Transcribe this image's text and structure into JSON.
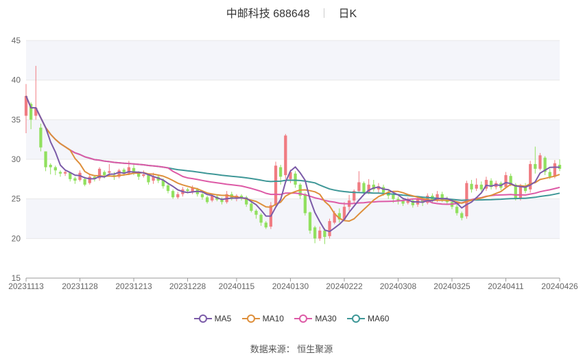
{
  "header": {
    "stock": "中邮科技 688648",
    "period": "日K"
  },
  "source": "数据来源：  恒生聚源",
  "colors": {
    "up": "#f07c82",
    "down": "#91e05f",
    "ma5": "#7b5ba8",
    "ma10": "#de8f3b",
    "ma30": "#dd5aa6",
    "ma60": "#3e9797",
    "grid": "#e8e8e8",
    "band": "#f4f5fa"
  },
  "chart_data": {
    "type": "candlestick",
    "title": "中邮科技 688648",
    "ylim": [
      15,
      45
    ],
    "yticks": [
      15,
      20,
      25,
      30,
      35,
      40,
      45
    ],
    "xtick_labels": [
      "20231113",
      "20231128",
      "20231213",
      "20231228",
      "20240115",
      "20240130",
      "20240222",
      "20240308",
      "20240325",
      "20240411",
      "20240426"
    ],
    "xtick_index": [
      0,
      11,
      22,
      33,
      43,
      54,
      65,
      76,
      87,
      98,
      109
    ],
    "legend": [
      "MA5",
      "MA10",
      "MA30",
      "MA60"
    ],
    "ohlc": [
      [
        35.5,
        38.0,
        39.5,
        33.3
      ],
      [
        37.0,
        35.0,
        37.2,
        33.8
      ],
      [
        35.5,
        36.5,
        41.8,
        35.0
      ],
      [
        34.0,
        31.5,
        34.5,
        31.0
      ],
      [
        31.0,
        29.0,
        31.0,
        28.5
      ],
      [
        29.3,
        29.0,
        29.5,
        28.1
      ],
      [
        29.0,
        28.6,
        29.2,
        28.0
      ],
      [
        28.4,
        28.2,
        28.6,
        27.8
      ],
      [
        28.2,
        28.4,
        28.6,
        27.9
      ],
      [
        28.3,
        27.5,
        28.4,
        27.2
      ],
      [
        27.6,
        27.3,
        27.8,
        26.9
      ],
      [
        27.4,
        28.3,
        28.6,
        27.2
      ],
      [
        27.5,
        26.8,
        27.8,
        26.6
      ],
      [
        27.0,
        27.8,
        28.1,
        26.8
      ],
      [
        27.8,
        27.5,
        28.0,
        27.2
      ],
      [
        27.6,
        28.8,
        29.0,
        27.3
      ],
      [
        28.4,
        28.0,
        28.6,
        27.6
      ],
      [
        28.3,
        28.5,
        29.4,
        27.8
      ],
      [
        28.0,
        27.9,
        28.4,
        27.4
      ],
      [
        27.8,
        28.6,
        28.8,
        27.6
      ],
      [
        28.7,
        28.2,
        28.9,
        27.9
      ],
      [
        28.2,
        29.0,
        29.8,
        28.0
      ],
      [
        28.9,
        28.3,
        29.3,
        28.0
      ],
      [
        28.3,
        27.8,
        28.5,
        27.4
      ],
      [
        27.9,
        28.1,
        28.6,
        27.7
      ],
      [
        28.0,
        27.1,
        28.2,
        26.8
      ],
      [
        27.3,
        27.8,
        28.3,
        26.9
      ],
      [
        27.8,
        27.3,
        28.0,
        27.0
      ],
      [
        27.4,
        26.6,
        27.6,
        26.3
      ],
      [
        26.7,
        26.0,
        26.9,
        25.7
      ],
      [
        26.0,
        25.2,
        26.2,
        25.0
      ],
      [
        25.2,
        25.6,
        25.9,
        25.0
      ],
      [
        25.6,
        26.2,
        26.5,
        25.3
      ],
      [
        26.2,
        26.0,
        26.4,
        25.7
      ],
      [
        25.9,
        26.4,
        26.7,
        25.6
      ],
      [
        26.2,
        25.6,
        26.4,
        25.3
      ],
      [
        25.6,
        25.2,
        25.8,
        24.9
      ],
      [
        25.2,
        24.6,
        25.4,
        24.4
      ],
      [
        24.8,
        25.4,
        25.6,
        24.6
      ],
      [
        25.3,
        24.9,
        25.6,
        24.7
      ],
      [
        24.9,
        24.6,
        25.2,
        24.3
      ],
      [
        24.6,
        25.6,
        26.0,
        24.4
      ],
      [
        25.6,
        25.0,
        25.9,
        24.8
      ],
      [
        25.0,
        25.4,
        25.6,
        24.7
      ],
      [
        25.4,
        25.1,
        25.6,
        24.8
      ],
      [
        25.2,
        24.3,
        25.4,
        24.0
      ],
      [
        24.4,
        23.5,
        24.6,
        23.3
      ],
      [
        23.5,
        23.0,
        23.7,
        22.5
      ],
      [
        23.0,
        22.0,
        23.2,
        21.6
      ],
      [
        22.0,
        21.4,
        22.2,
        21.2
      ],
      [
        21.5,
        24.2,
        24.6,
        21.2
      ],
      [
        24.2,
        29.2,
        29.7,
        24.0
      ],
      [
        29.0,
        27.8,
        29.3,
        26.8
      ],
      [
        28.0,
        33.0,
        33.2,
        27.5
      ],
      [
        27.5,
        28.4,
        28.7,
        27.0
      ],
      [
        28.2,
        26.8,
        28.5,
        26.4
      ],
      [
        26.8,
        25.4,
        27.0,
        25.0
      ],
      [
        25.6,
        23.2,
        25.8,
        22.9
      ],
      [
        23.3,
        21.0,
        23.4,
        20.6
      ],
      [
        21.4,
        20.0,
        21.6,
        19.4
      ],
      [
        20.0,
        21.0,
        21.5,
        19.7
      ],
      [
        21.0,
        20.2,
        21.3,
        19.3
      ],
      [
        20.3,
        22.2,
        22.5,
        20.0
      ],
      [
        22.0,
        23.2,
        23.5,
        21.8
      ],
      [
        23.2,
        22.4,
        23.8,
        22.0
      ],
      [
        22.4,
        24.0,
        24.6,
        22.2
      ],
      [
        24.0,
        24.8,
        25.5,
        23.5
      ],
      [
        24.8,
        26.0,
        26.2,
        24.5
      ],
      [
        26.0,
        27.1,
        28.5,
        25.8
      ],
      [
        27.0,
        25.8,
        27.2,
        25.6
      ],
      [
        25.8,
        26.8,
        27.5,
        25.6
      ],
      [
        26.8,
        26.2,
        27.4,
        25.9
      ],
      [
        26.2,
        26.6,
        27.0,
        25.8
      ],
      [
        26.5,
        25.8,
        26.8,
        25.4
      ],
      [
        25.8,
        25.4,
        26.2,
        25.0
      ],
      [
        25.5,
        25.0,
        25.7,
        24.5
      ],
      [
        25.0,
        24.7,
        25.3,
        24.3
      ],
      [
        24.8,
        24.4,
        25.0,
        24.1
      ],
      [
        24.5,
        24.8,
        25.2,
        24.3
      ],
      [
        24.8,
        24.2,
        25.0,
        23.9
      ],
      [
        24.3,
        25.0,
        25.3,
        24.0
      ],
      [
        25.0,
        24.5,
        25.2,
        24.1
      ],
      [
        24.5,
        25.4,
        25.7,
        24.3
      ],
      [
        25.4,
        24.8,
        25.7,
        24.5
      ],
      [
        24.8,
        25.6,
        26.0,
        24.6
      ],
      [
        25.6,
        24.9,
        25.9,
        24.6
      ],
      [
        24.9,
        24.6,
        25.3,
        24.3
      ],
      [
        24.6,
        24.0,
        24.8,
        23.7
      ],
      [
        24.0,
        23.2,
        24.3,
        22.9
      ],
      [
        23.2,
        22.6,
        23.4,
        22.3
      ],
      [
        22.8,
        27.0,
        27.3,
        22.5
      ],
      [
        26.9,
        26.2,
        27.4,
        25.8
      ],
      [
        26.3,
        26.8,
        27.6,
        26.0
      ],
      [
        26.8,
        26.2,
        27.2,
        25.9
      ],
      [
        26.3,
        27.4,
        27.8,
        26.0
      ],
      [
        27.3,
        26.5,
        27.6,
        26.2
      ],
      [
        26.5,
        27.0,
        27.3,
        26.2
      ],
      [
        27.0,
        26.4,
        27.2,
        26.1
      ],
      [
        26.5,
        28.0,
        28.4,
        26.3
      ],
      [
        27.9,
        26.8,
        28.2,
        26.6
      ],
      [
        26.8,
        25.0,
        27.0,
        24.8
      ],
      [
        25.0,
        26.6,
        26.9,
        24.8
      ],
      [
        26.6,
        26.0,
        27.0,
        25.7
      ],
      [
        26.2,
        29.4,
        29.8,
        25.8
      ],
      [
        29.4,
        28.8,
        31.6,
        28.2
      ],
      [
        28.8,
        30.5,
        30.8,
        28.6
      ],
      [
        30.2,
        28.4,
        30.4,
        28.0
      ],
      [
        28.4,
        27.8,
        28.8,
        27.5
      ],
      [
        27.8,
        29.5,
        29.9,
        27.6
      ],
      [
        29.3,
        28.8,
        30.0,
        28.5
      ]
    ]
  }
}
